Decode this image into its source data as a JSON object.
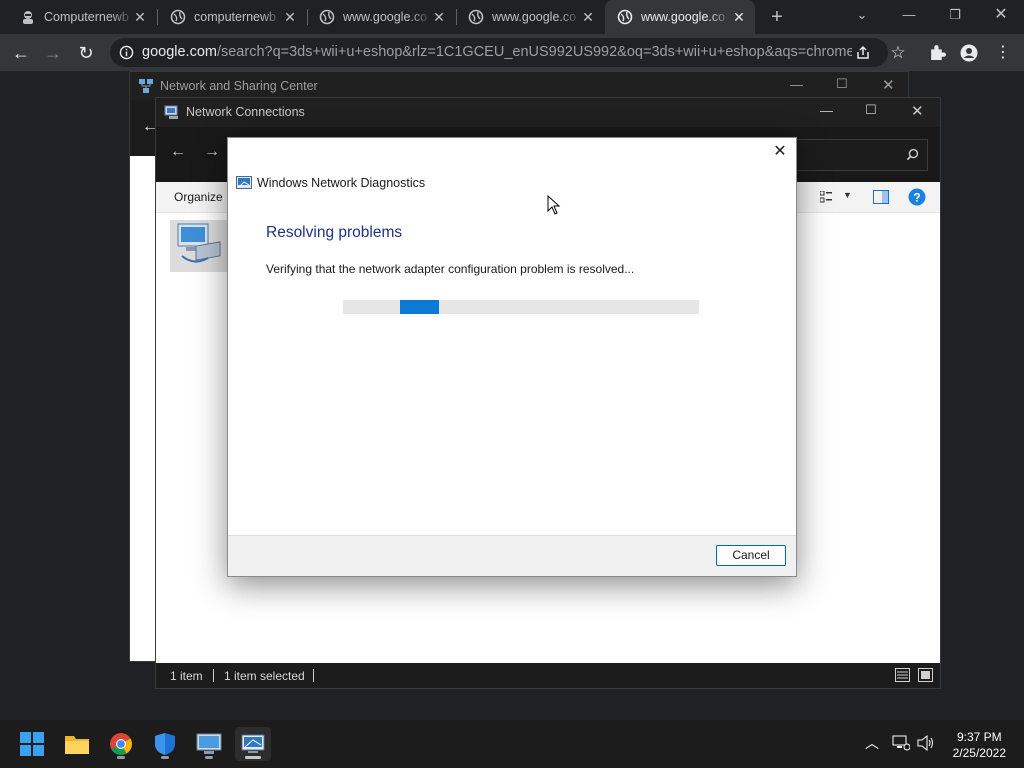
{
  "browser": {
    "tabs": [
      {
        "title": "Computernewb",
        "active": false
      },
      {
        "title": "computernewb",
        "active": false
      },
      {
        "title": "www.google.co",
        "active": false
      },
      {
        "title": "www.google.co",
        "active": false
      },
      {
        "title": "www.google.co",
        "active": true
      }
    ],
    "url_domain": "google.com",
    "url_rest": "/search?q=3ds+wii+u+eshop&rlz=1C1GCEU_enUS992US992&oq=3ds+wii+u+eshop&aqs=chrome...."
  },
  "nsc_window": {
    "title": "Network and Sharing Center"
  },
  "nc_window": {
    "title": "Network Connections",
    "organize_label": "Organize",
    "status": {
      "count": "1 item",
      "selected": "1 item selected"
    }
  },
  "dialog": {
    "title": "Windows Network Diagnostics",
    "heading": "Resolving problems",
    "message": "Verifying that the network adapter configuration problem is resolved...",
    "progress_start": 0.16,
    "progress_end": 0.27,
    "cancel_label": "Cancel"
  },
  "taskbar": {
    "time": "9:37 PM",
    "date": "2/25/2022"
  },
  "colors": {
    "accent": "#0a7ad6",
    "heading": "#1e3287",
    "help": "#1a82e2"
  }
}
